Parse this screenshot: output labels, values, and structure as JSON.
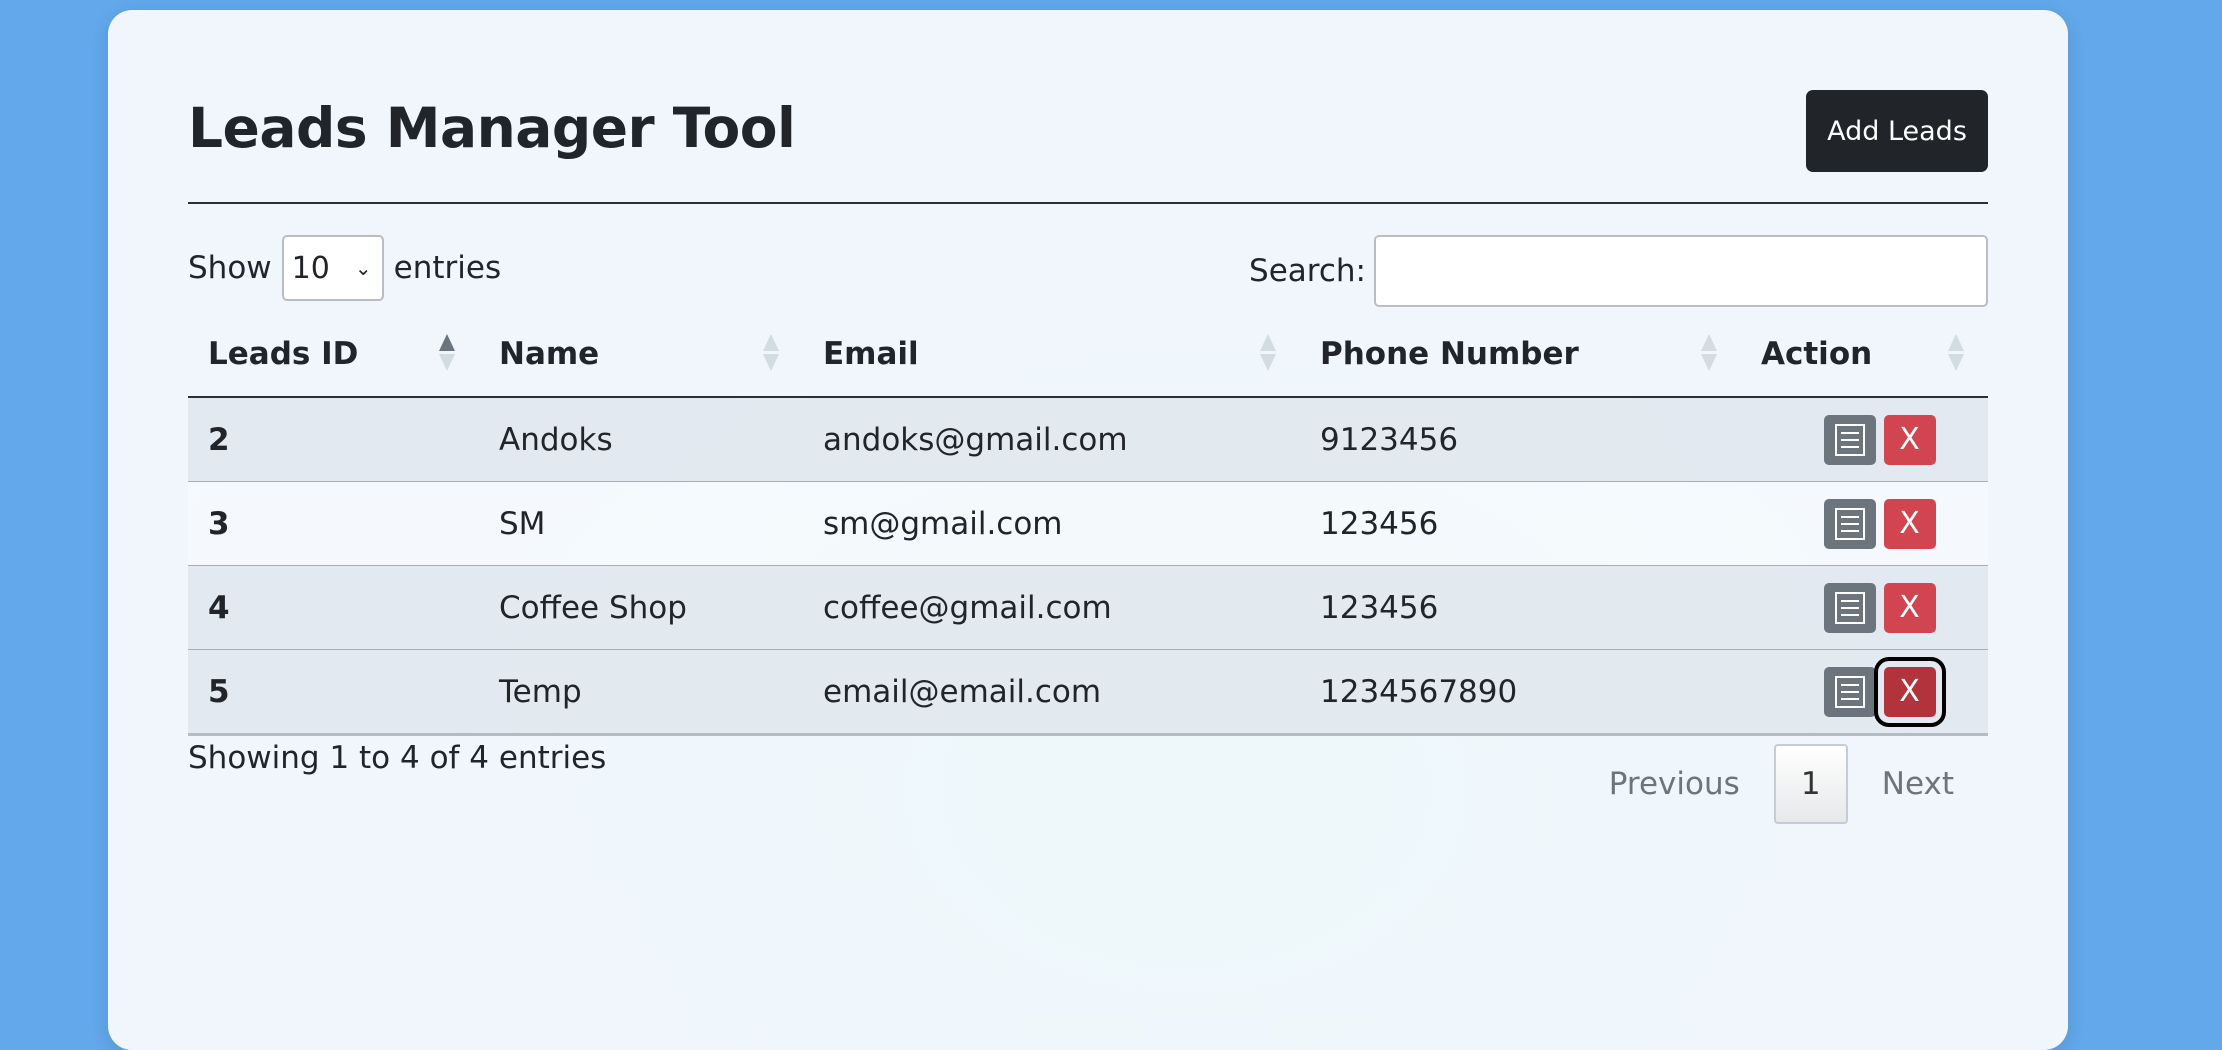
{
  "page": {
    "title": "Leads Manager Tool",
    "add_button": "Add Leads"
  },
  "controls": {
    "show_label": "Show",
    "entries_value": "10",
    "entries_label": "entries",
    "search_label": "Search:",
    "search_value": ""
  },
  "table": {
    "headers": [
      "Leads ID",
      "Name",
      "Email",
      "Phone Number",
      "Action"
    ],
    "rows": [
      {
        "id": "2",
        "name": "Andoks",
        "email": "andoks@gmail.com",
        "phone": "9123456"
      },
      {
        "id": "3",
        "name": "SM",
        "email": "sm@gmail.com",
        "phone": "123456"
      },
      {
        "id": "4",
        "name": "Coffee Shop",
        "email": "coffee@gmail.com",
        "phone": "123456"
      },
      {
        "id": "5",
        "name": "Temp",
        "email": "email@email.com",
        "phone": "1234567890"
      }
    ],
    "delete_label": "X"
  },
  "footer": {
    "info": "Showing 1 to 4 of 4 entries",
    "previous": "Previous",
    "page": "1",
    "next": "Next"
  },
  "colors": {
    "background": "#62a8eb",
    "primary_dark": "#212529",
    "edit": "#6c757d",
    "delete": "#d0454f"
  }
}
